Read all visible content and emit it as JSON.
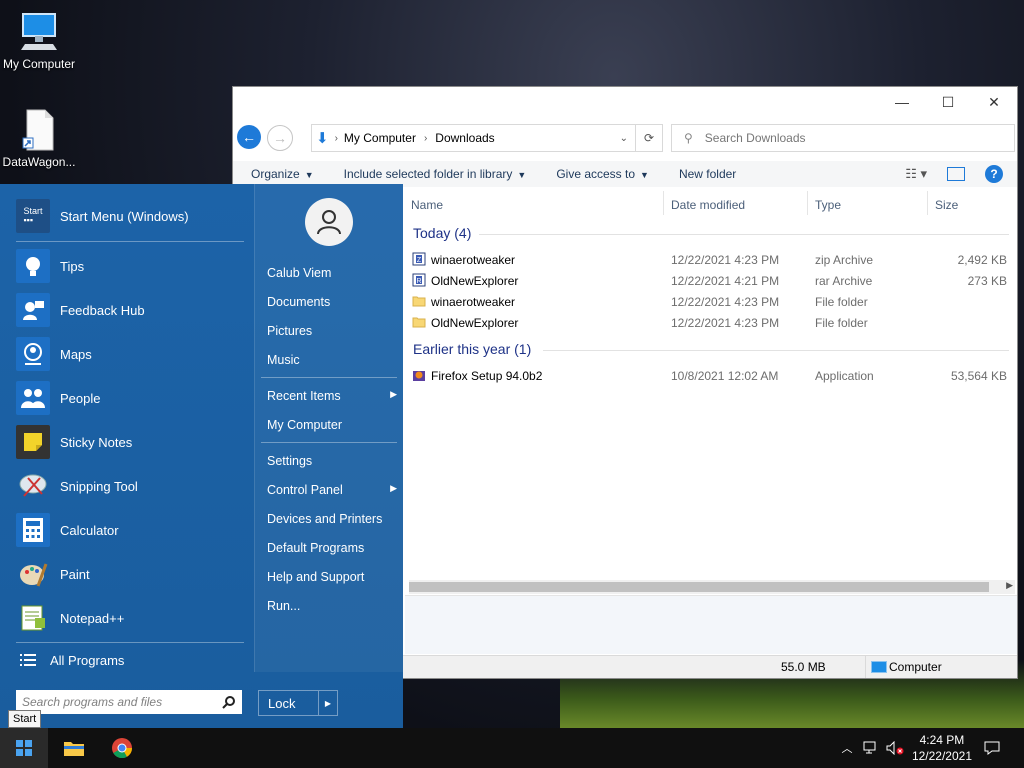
{
  "desktop": {
    "icons": [
      {
        "label": "My Computer"
      },
      {
        "label": "DataWagon..."
      }
    ]
  },
  "explorer": {
    "breadcrumb": [
      "My Computer",
      "Downloads"
    ],
    "search_placeholder": "Search Downloads",
    "commands": [
      "Organize",
      "Include selected folder in library",
      "Give access to",
      "New folder"
    ],
    "columns": [
      "Name",
      "Date modified",
      "Type",
      "Size"
    ],
    "groups": [
      {
        "title": "Today (4)",
        "files": [
          {
            "name": "winaerotweaker",
            "date": "12/22/2021 4:23 PM",
            "type": "zip Archive",
            "size": "2,492 KB",
            "icon": "zip-archive-icon"
          },
          {
            "name": "OldNewExplorer",
            "date": "12/22/2021 4:21 PM",
            "type": "rar Archive",
            "size": "273 KB",
            "icon": "rar-archive-icon"
          },
          {
            "name": "winaerotweaker",
            "date": "12/22/2021 4:23 PM",
            "type": "File folder",
            "size": "",
            "icon": "folder-icon"
          },
          {
            "name": "OldNewExplorer",
            "date": "12/22/2021 4:23 PM",
            "type": "File folder",
            "size": "",
            "icon": "folder-icon"
          }
        ]
      },
      {
        "title": "Earlier this year (1)",
        "files": [
          {
            "name": "Firefox Setup 94.0b2",
            "date": "10/8/2021 12:02 AM",
            "type": "Application",
            "size": "53,564 KB",
            "icon": "firefox-setup-icon"
          }
        ]
      }
    ],
    "status": {
      "size": "55.0 MB",
      "location": "Computer"
    }
  },
  "start_menu": {
    "pinned": [
      {
        "label": "Start Menu (Windows)",
        "color": "#1e4f86"
      },
      {
        "label": "Tips",
        "color": "#1d6fc4"
      },
      {
        "label": "Feedback Hub",
        "color": "#1d6fc4"
      },
      {
        "label": "Maps",
        "color": "#1d6fc4"
      },
      {
        "label": "People",
        "color": "#1d6fc4"
      },
      {
        "label": "Sticky Notes",
        "color": "#f2d32a"
      },
      {
        "label": "Snipping Tool",
        "color": "#1d6fc4"
      },
      {
        "label": "Calculator",
        "color": "#1d6fc4"
      },
      {
        "label": "Paint",
        "color": "#1d6fc4"
      },
      {
        "label": "Notepad++",
        "color": "#8fbf3a"
      }
    ],
    "all_programs": "All Programs",
    "user": "Calub Viem",
    "right_items": [
      {
        "label": "Documents"
      },
      {
        "label": "Pictures"
      },
      {
        "label": "Music"
      },
      {
        "label": "Recent Items",
        "submenu": true
      },
      {
        "label": "My Computer"
      },
      {
        "label": "Settings"
      },
      {
        "label": "Control Panel",
        "submenu": true
      },
      {
        "label": "Devices and Printers"
      },
      {
        "label": "Default Programs"
      },
      {
        "label": "Help and Support"
      },
      {
        "label": "Run..."
      }
    ],
    "search_placeholder": "Search programs and files",
    "lock_label": "Lock"
  },
  "tooltip": "Start",
  "taskbar": {
    "time": "4:24 PM",
    "date": "12/22/2021"
  }
}
